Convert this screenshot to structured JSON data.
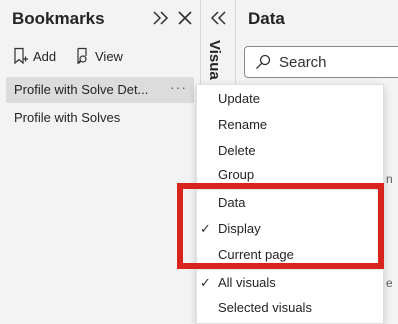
{
  "bookmarks": {
    "title": "Bookmarks",
    "add_label": "Add",
    "view_label": "View",
    "items": [
      {
        "label": "Profile with Solve Det..."
      },
      {
        "label": "Profile with Solves"
      }
    ],
    "more_label": "···"
  },
  "visualizations": {
    "label": "Visua"
  },
  "data_pane": {
    "title": "Data",
    "search_placeholder": "Search",
    "peek_texts": [
      "n",
      "e"
    ]
  },
  "context_menu": {
    "items": [
      {
        "label": "Update",
        "checked": false
      },
      {
        "label": "Rename",
        "checked": false
      },
      {
        "label": "Delete",
        "checked": false
      },
      {
        "label": "Group",
        "checked": false
      },
      {
        "label": "Data",
        "checked": false
      },
      {
        "label": "Display",
        "checked": true
      },
      {
        "label": "Current page",
        "checked": false
      },
      {
        "label": "All visuals",
        "checked": true
      },
      {
        "label": "Selected visuals",
        "checked": false
      }
    ],
    "check_glyph": "✓"
  },
  "colors": {
    "highlight": "#d9231d",
    "pane_bg": "#f3f3f3",
    "selected_bg": "#dcdcdc",
    "menu_bg": "#ffffff"
  }
}
